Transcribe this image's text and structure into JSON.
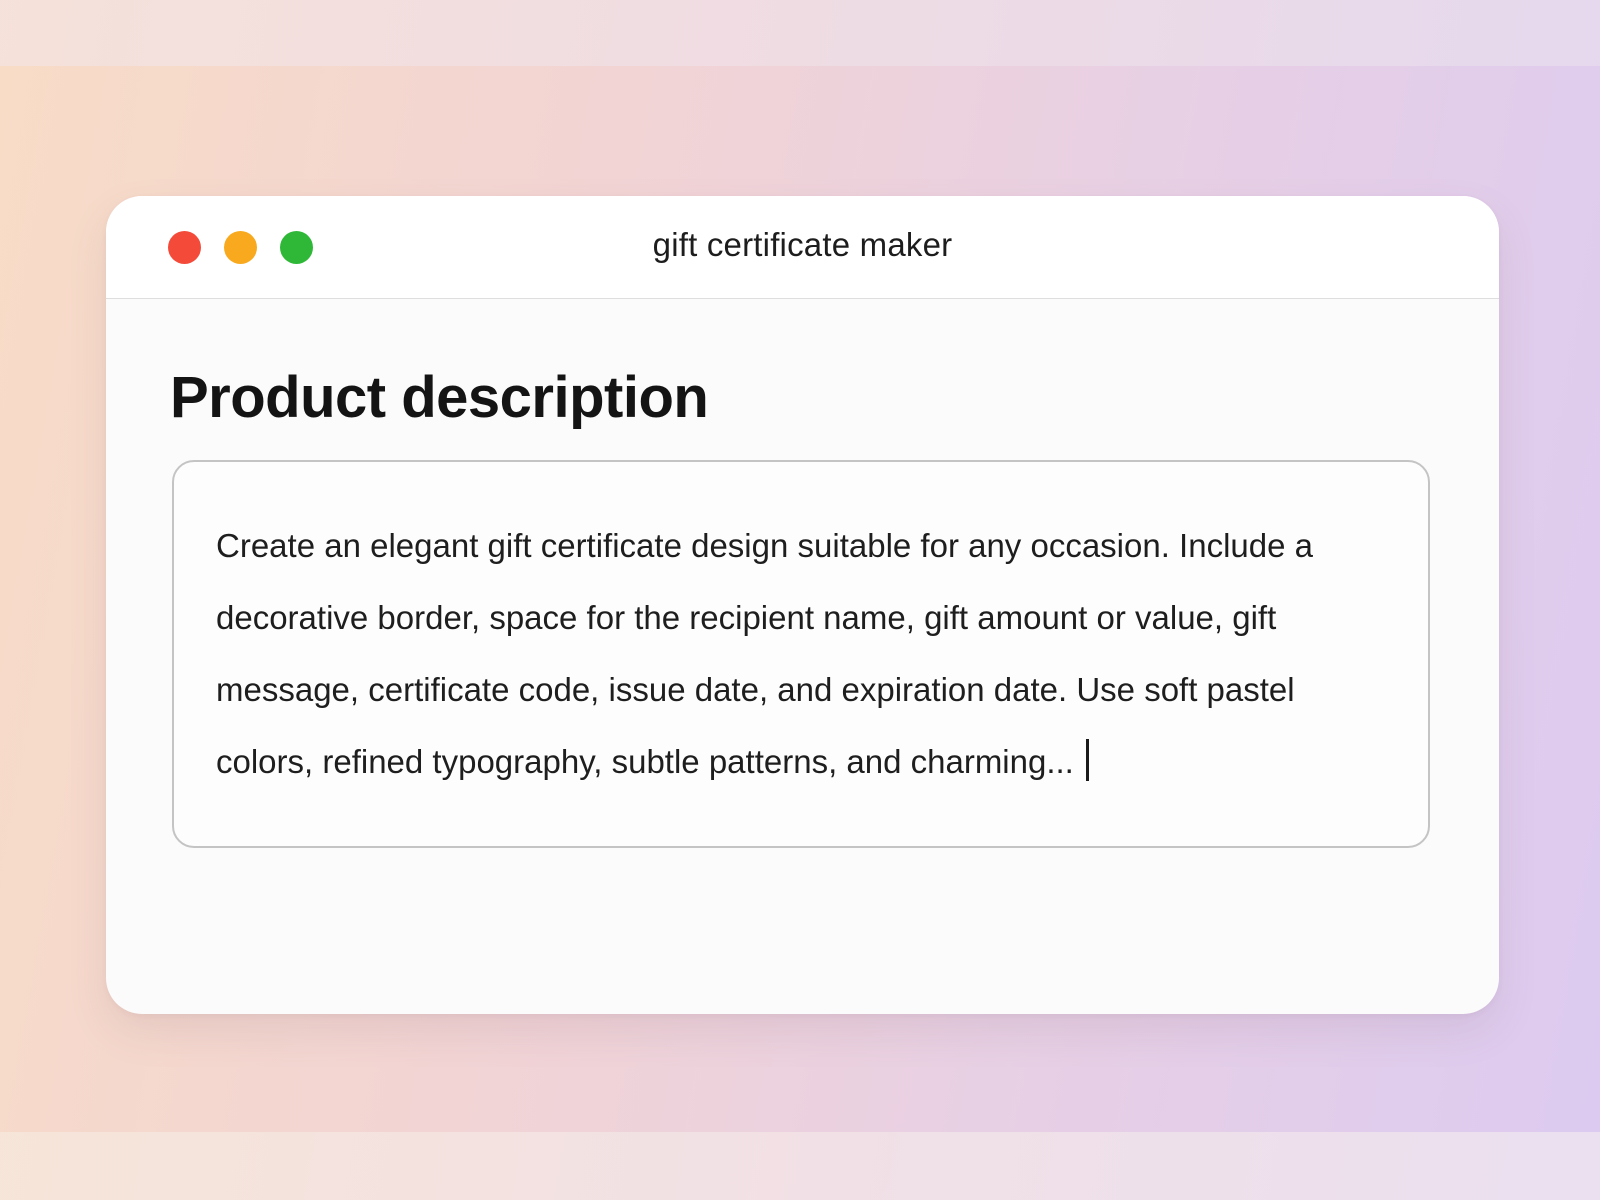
{
  "window": {
    "title": "gift certificate maker"
  },
  "controls": {
    "close_color": "#f44a3a",
    "minimize_color": "#f8a91e",
    "zoom_color": "#2fb838"
  },
  "main": {
    "heading": "Product description",
    "description": {
      "value": "Create an elegant gift certificate design suitable for any occasion. Include a decorative border, space for the recipient name, gift amount or value, gift message, certificate code, issue date, and expiration date. Use soft pastel colors, refined typography, subtle patterns, and charming..."
    }
  }
}
